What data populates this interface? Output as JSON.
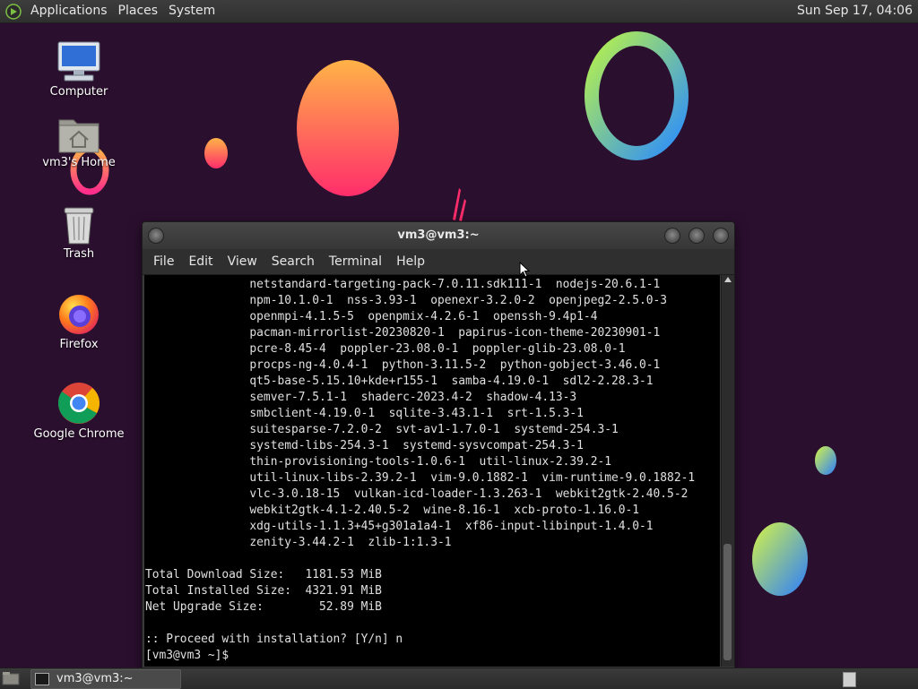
{
  "top_panel": {
    "menus": [
      "Applications",
      "Places",
      "System"
    ],
    "clock": "Sun Sep 17, 04:06"
  },
  "desktop": {
    "icons": [
      {
        "label": "Computer",
        "icon": "computer-icon"
      },
      {
        "label": "vm3's Home",
        "icon": "home-folder-icon"
      },
      {
        "label": "Trash",
        "icon": "trash-icon"
      },
      {
        "label": "Firefox",
        "icon": "firefox-icon"
      },
      {
        "label": "Google Chrome",
        "icon": "chrome-icon"
      }
    ]
  },
  "terminal": {
    "title": "vm3@vm3:~",
    "menu": [
      "File",
      "Edit",
      "View",
      "Search",
      "Terminal",
      "Help"
    ],
    "lines": [
      "               netstandard-targeting-pack-7.0.11.sdk111-1  nodejs-20.6.1-1",
      "               npm-10.1.0-1  nss-3.93-1  openexr-3.2.0-2  openjpeg2-2.5.0-3",
      "               openmpi-4.1.5-5  openpmix-4.2.6-1  openssh-9.4p1-4",
      "               pacman-mirrorlist-20230820-1  papirus-icon-theme-20230901-1",
      "               pcre-8.45-4  poppler-23.08.0-1  poppler-glib-23.08.0-1",
      "               procps-ng-4.0.4-1  python-3.11.5-2  python-gobject-3.46.0-1",
      "               qt5-base-5.15.10+kde+r155-1  samba-4.19.0-1  sdl2-2.28.3-1",
      "               semver-7.5.1-1  shaderc-2023.4-2  shadow-4.13-3",
      "               smbclient-4.19.0-1  sqlite-3.43.1-1  srt-1.5.3-1",
      "               suitesparse-7.2.0-2  svt-av1-1.7.0-1  systemd-254.3-1",
      "               systemd-libs-254.3-1  systemd-sysvcompat-254.3-1",
      "               thin-provisioning-tools-1.0.6-1  util-linux-2.39.2-1",
      "               util-linux-libs-2.39.2-1  vim-9.0.1882-1  vim-runtime-9.0.1882-1",
      "               vlc-3.0.18-15  vulkan-icd-loader-1.3.263-1  webkit2gtk-2.40.5-2",
      "               webkit2gtk-4.1-2.40.5-2  wine-8.16-1  xcb-proto-1.16.0-1",
      "               xdg-utils-1.1.3+45+g301a1a4-1  xf86-input-libinput-1.4.0-1",
      "               zenity-3.44.2-1  zlib-1:1.3-1",
      "",
      "Total Download Size:   1181.53 MiB",
      "Total Installed Size:  4321.91 MiB",
      "Net Upgrade Size:        52.89 MiB",
      "",
      ":: Proceed with installation? [Y/n] n",
      "[vm3@vm3 ~]$ "
    ]
  },
  "taskbar": {
    "windows": [
      {
        "label": "vm3@vm3:~"
      }
    ]
  }
}
